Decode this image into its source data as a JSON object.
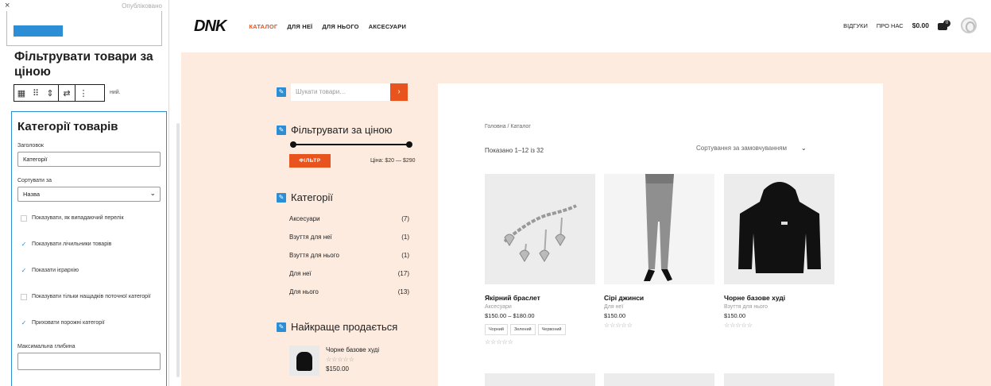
{
  "editor": {
    "close": "×",
    "status": "Опубліковано",
    "filter_heading": "Фільтрувати товари за ціною",
    "toolbar_tail": "ний.",
    "block_title": "Категорії товарів",
    "title_label": "Заголовок",
    "title_value": "Категорії",
    "sort_label": "Сортувати за",
    "sort_value": "Назва",
    "options": [
      {
        "label": "Показувати, як випадаючий перелік",
        "checked": false
      },
      {
        "label": "Показувати лічильники товарів",
        "checked": true
      },
      {
        "label": "Показати ієрархію",
        "checked": true
      },
      {
        "label": "Показувати тільки нащадків поточної категорії",
        "checked": false
      },
      {
        "label": "Приховати порожні категорії",
        "checked": true
      }
    ],
    "depth_label": "Максимальна глибина"
  },
  "header": {
    "logo": "DNK",
    "nav": [
      "КАТАЛОГ",
      "ДЛЯ НЕЇ",
      "ДЛЯ НЬОГО",
      "АКСЕСУАРИ"
    ],
    "right_links": [
      "ВІДГУКИ",
      "ПРО НАС"
    ],
    "cart_total": "$0.00",
    "cart_count": "0"
  },
  "sidebar": {
    "search_placeholder": "Шукати товари…",
    "search_go": "›",
    "price_title": "Фільтрувати за ціною",
    "filter_button": "ФІЛЬТР",
    "price_range": "Ціна: $20 — $290",
    "cat_title": "Категорії",
    "categories": [
      {
        "name": "Аксесуари",
        "count": "(7)"
      },
      {
        "name": "Взуття для неї",
        "count": "(1)"
      },
      {
        "name": "Взуття для нього",
        "count": "(1)"
      },
      {
        "name": "Для неї",
        "count": "(17)"
      },
      {
        "name": "Для нього",
        "count": "(13)"
      }
    ],
    "best_title": "Найкраще продається",
    "best_item": {
      "name": "Чорне базове худі",
      "stars": "☆☆☆☆☆",
      "price": "$150.00"
    }
  },
  "catalog": {
    "breadcrumb": "Головна / Каталог",
    "result_count": "Показано 1–12 із 32",
    "sort_value": "Сортування за замовчуванням",
    "products": [
      {
        "name": "Якірний браслет",
        "category": "Аксесуари",
        "price": "$150.00 – $180.00",
        "tags": [
          "Чорний",
          "Зелений",
          "Червоний"
        ],
        "stars": "☆☆☆☆☆"
      },
      {
        "name": "Сірі джинси",
        "category": "Для неї",
        "price": "$150.00",
        "tags": [],
        "stars": "☆☆☆☆☆"
      },
      {
        "name": "Чорне базове худі",
        "category": "Взуття для нього",
        "price": "$150.00",
        "tags": [],
        "stars": "☆☆☆☆☆"
      }
    ]
  },
  "colors": {
    "accent": "#e8531e",
    "editor_blue": "#2c8fd6",
    "page_bg": "#fdebe0"
  }
}
